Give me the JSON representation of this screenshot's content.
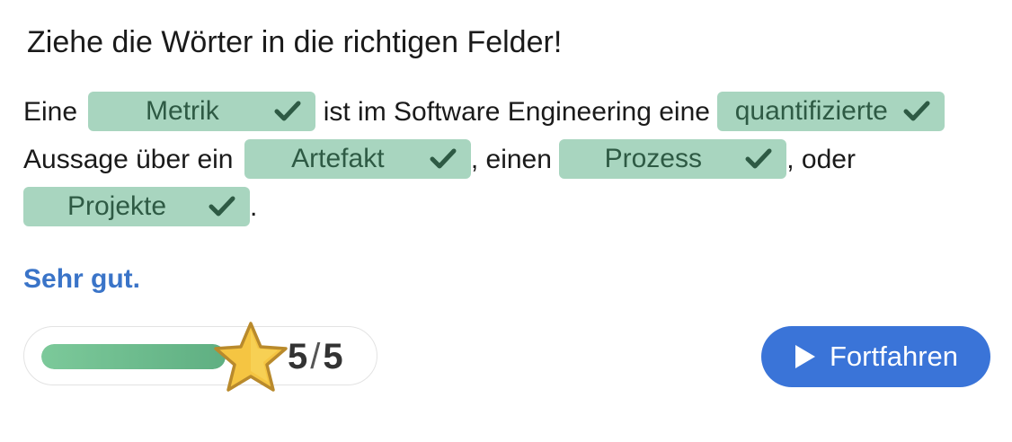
{
  "instruction": "Ziehe die Wörter in die richtigen Felder!",
  "sentence": {
    "t1": "Eine ",
    "blank1": "Metrik",
    "t2": " ist im Software Engineering eine ",
    "blank2": "quantifizierte",
    "t3": "Aussage über ein ",
    "blank3": "Artefakt",
    "t4": ", einen ",
    "blank4": "Prozess",
    "t5": ", oder",
    "blank5": "Projekte",
    "t6": "."
  },
  "feedback": "Sehr gut.",
  "score": {
    "current": "5",
    "separator": "/",
    "total": "5",
    "progress_fraction": 1.0
  },
  "continue_button": {
    "label": "Fortfahren",
    "icon": "play-icon"
  },
  "colors": {
    "dropzone_bg": "#a8d5bf",
    "dropzone_text": "#2e5a44",
    "feedback": "#3a74c8",
    "button": "#3a74d8",
    "progress": "#6cbf8e",
    "star": "#f5c542"
  }
}
